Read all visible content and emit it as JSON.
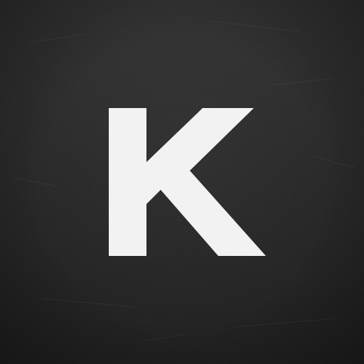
{
  "app_icon": {
    "letter": "K",
    "background_color": "#1e1e1e",
    "letter_color": "#f2f2f2",
    "texture": "scratched-chalkboard"
  }
}
